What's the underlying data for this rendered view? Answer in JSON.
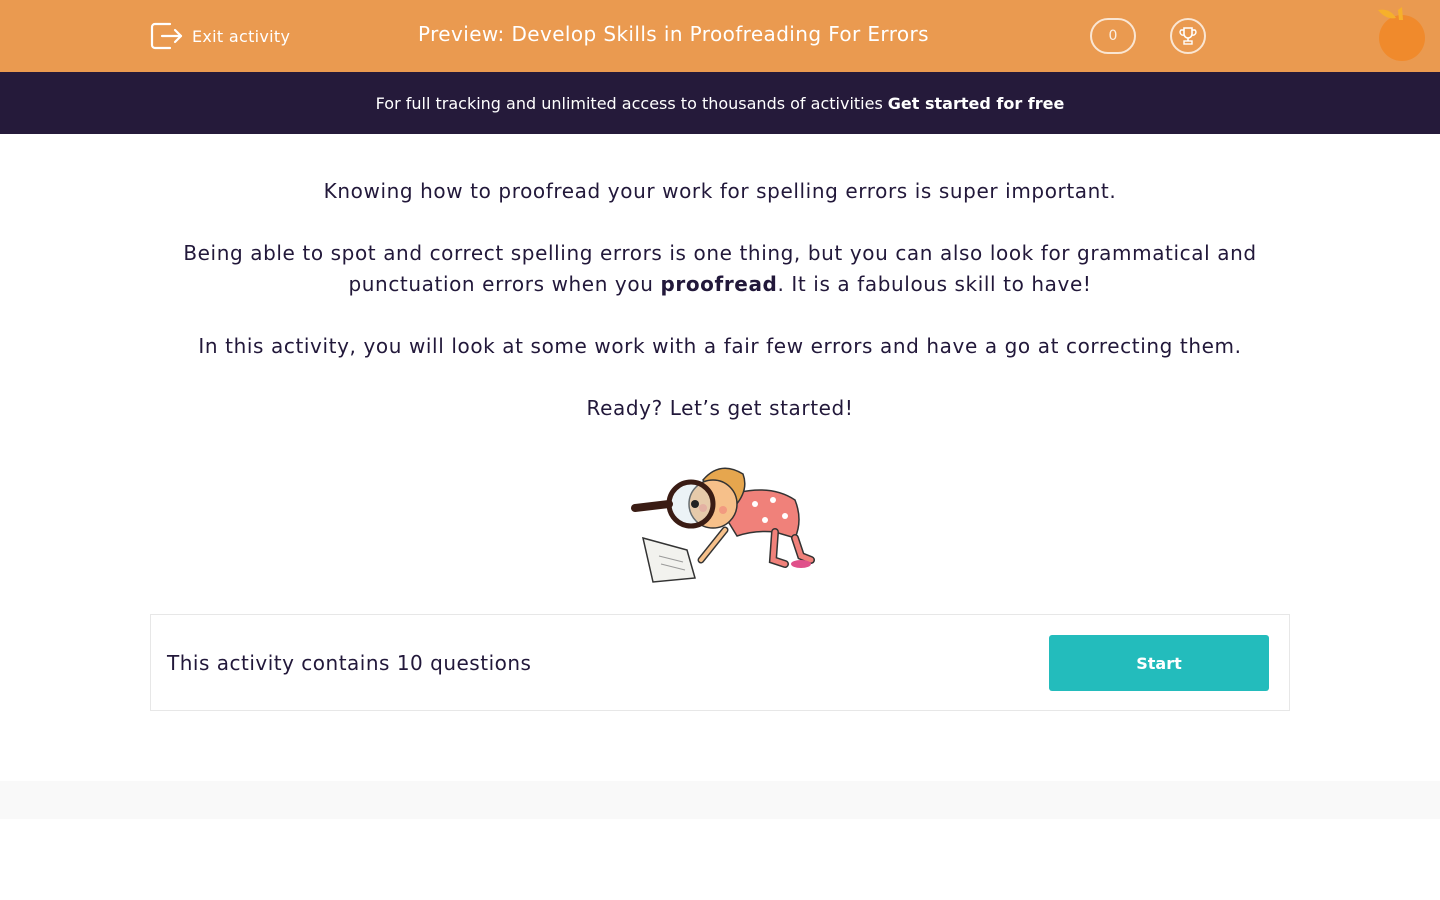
{
  "header": {
    "exit_label": "Exit activity",
    "title": "Preview: Develop Skills in Proofreading For Errors",
    "score": "0",
    "background_color": "#ea9a50"
  },
  "banner": {
    "text": "For full tracking and unlimited access to thousands of activities",
    "cta": "Get started for free",
    "background_color": "#251a3a"
  },
  "intro": {
    "p1": "Knowing how to proofread your work for spelling errors is super important.",
    "p2_before": "Being able to spot and correct spelling errors is one thing, but you can also look for grammatical and punctuation errors when you",
    "p2_bold": "proofread",
    "p2_after": ". It is a fabulous skill to have!",
    "p3": "In this activity, you will look at some work with a fair few errors and have a go at correcting them.",
    "p4": "Ready? Let’s get started!"
  },
  "activity": {
    "info": "This activity contains 10 questions",
    "start_label": "Start",
    "button_color": "#23bcbc"
  },
  "icons": {
    "exit": "exit-icon",
    "trophy": "trophy-icon",
    "logo": "orange-logo-icon",
    "illustration": "girl-with-magnifying-glass-illustration"
  }
}
